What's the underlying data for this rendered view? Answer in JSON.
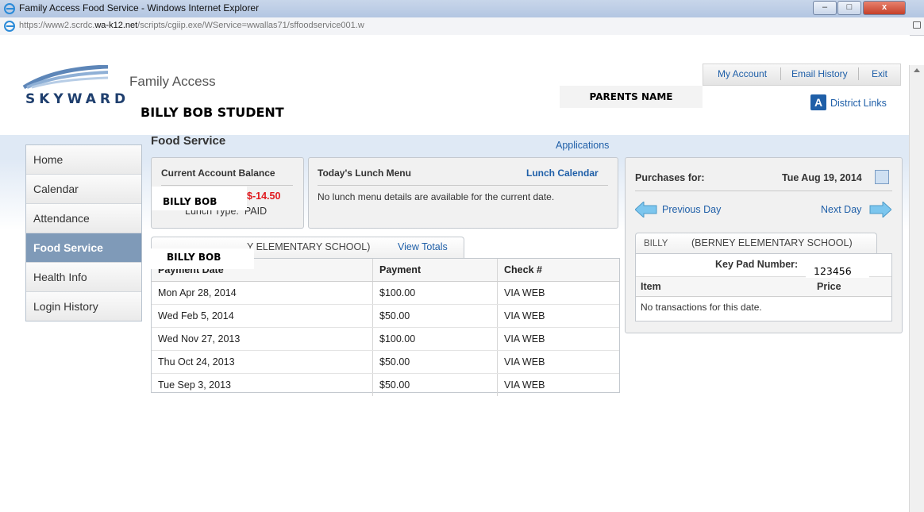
{
  "browser": {
    "title": "Family Access Food Service - Windows Internet Explorer",
    "url_prefix": "https://www2.scrdc.",
    "url_domain": "wa-k12.net",
    "url_rest": "/scripts/cgiip.exe/WService=wwallas71/sffoodservice001.w",
    "min": "–",
    "max": "□",
    "close": "x"
  },
  "header": {
    "logo_text": "SKYWARD",
    "app_name": "Family Access",
    "student_name": "BILLY BOB STUDENT",
    "parent_name": "PARENTS NAME",
    "links": [
      "My Account",
      "Email History",
      "Exit"
    ],
    "district_links": "District Links"
  },
  "sidebar": {
    "items": [
      "Home",
      "Calendar",
      "Attendance",
      "Food Service",
      "Health Info",
      "Login History"
    ],
    "active": "Food Service"
  },
  "page": {
    "title": "Food Service",
    "applications": "Applications"
  },
  "balance": {
    "heading": "Current Account Balance",
    "student": "BILLY BOB",
    "amount": "$-14.50",
    "lunch_type_label": "Lunch Type:",
    "lunch_type": "PAID"
  },
  "menu": {
    "heading": "Today's Lunch Menu",
    "calendar_link": "Lunch Calendar",
    "message": "No lunch menu details are available for the current date."
  },
  "payments": {
    "tab_student": "BILLY BOB",
    "tab_school": "Y ELEMENTARY SCHOOL)",
    "view_totals": "View Totals",
    "columns": [
      "Payment Date",
      "Payment",
      "Check #"
    ],
    "rows": [
      [
        "Mon Apr 28, 2014",
        "$100.00",
        "VIA WEB"
      ],
      [
        "Wed Feb 5, 2014",
        "$50.00",
        "VIA WEB"
      ],
      [
        "Wed Nov 27, 2013",
        "$100.00",
        "VIA WEB"
      ],
      [
        "Thu Oct 24, 2013",
        "$50.00",
        "VIA WEB"
      ],
      [
        "Tue Sep 3, 2013",
        "$50.00",
        "VIA WEB"
      ]
    ]
  },
  "purchases": {
    "label": "Purchases for:",
    "date": "Tue Aug 19, 2014",
    "prev": "Previous Day",
    "next": "Next Day",
    "tab_student": "BILLY",
    "tab_school": "(BERNEY ELEMENTARY SCHOOL)",
    "keypad_label": "Key Pad Number:",
    "keypad_value": "123456",
    "columns": [
      "Item",
      "Price"
    ],
    "empty": "No transactions for this date."
  },
  "colors": {
    "accent": "#1f5fa8",
    "negative": "#e0191e",
    "active_nav": "#7f9ab8"
  }
}
